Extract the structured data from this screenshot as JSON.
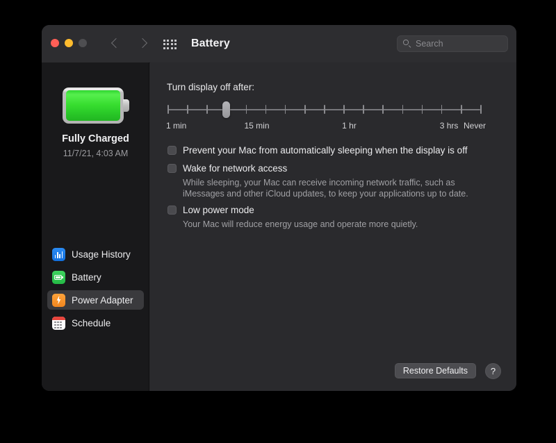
{
  "window": {
    "title": "Battery",
    "traffic_lights": [
      "close-red",
      "minimize-yellow",
      "zoom-disabled-gray"
    ],
    "nav_back_icon": "chevron-left-icon",
    "nav_forward_icon": "chevron-right-icon",
    "show_all_icon": "grid-icon"
  },
  "search": {
    "placeholder": "Search",
    "value": "",
    "icon": "search-icon"
  },
  "sidebar": {
    "battery_icon": "battery-full-green-icon",
    "status": "Fully Charged",
    "timestamp": "11/7/21, 4:03 AM",
    "items": [
      {
        "label": "Usage History",
        "icon": "usage-history-icon",
        "selected": false
      },
      {
        "label": "Battery",
        "icon": "battery-icon",
        "selected": false
      },
      {
        "label": "Power Adapter",
        "icon": "power-adapter-bolt-icon",
        "selected": true
      },
      {
        "label": "Schedule",
        "icon": "schedule-calendar-icon",
        "selected": false
      }
    ]
  },
  "main": {
    "slider": {
      "label": "Turn display off after:",
      "tick_count": 16,
      "knob_index": 3,
      "labels": [
        {
          "text": "1 min",
          "index": 0
        },
        {
          "text": "15 min",
          "index": 4
        },
        {
          "text": "1 hr",
          "index": 9
        },
        {
          "text": "3 hrs",
          "index": 14
        },
        {
          "text": "Never",
          "index": 16
        }
      ]
    },
    "options": [
      {
        "label": "Prevent your Mac from automatically sleeping when the display is off",
        "checked": false,
        "description": ""
      },
      {
        "label": "Wake for network access",
        "checked": false,
        "description": "While sleeping, your Mac can receive incoming network traffic, such as iMessages and other iCloud updates, to keep your applications up to date."
      },
      {
        "label": "Low power mode",
        "checked": false,
        "description": "Your Mac will reduce energy usage and operate more quietly."
      }
    ],
    "restore_defaults_label": "Restore Defaults",
    "help_label": "?"
  },
  "colors": {
    "accent_green": "#37dd2f",
    "accent_orange": "#f0861f",
    "accent_blue": "#1170e0",
    "accent_red": "#e8453c",
    "window_bg": "#2a2a2d",
    "sidebar_bg": "#19191b",
    "titlebar_bg": "#2d2d30"
  }
}
